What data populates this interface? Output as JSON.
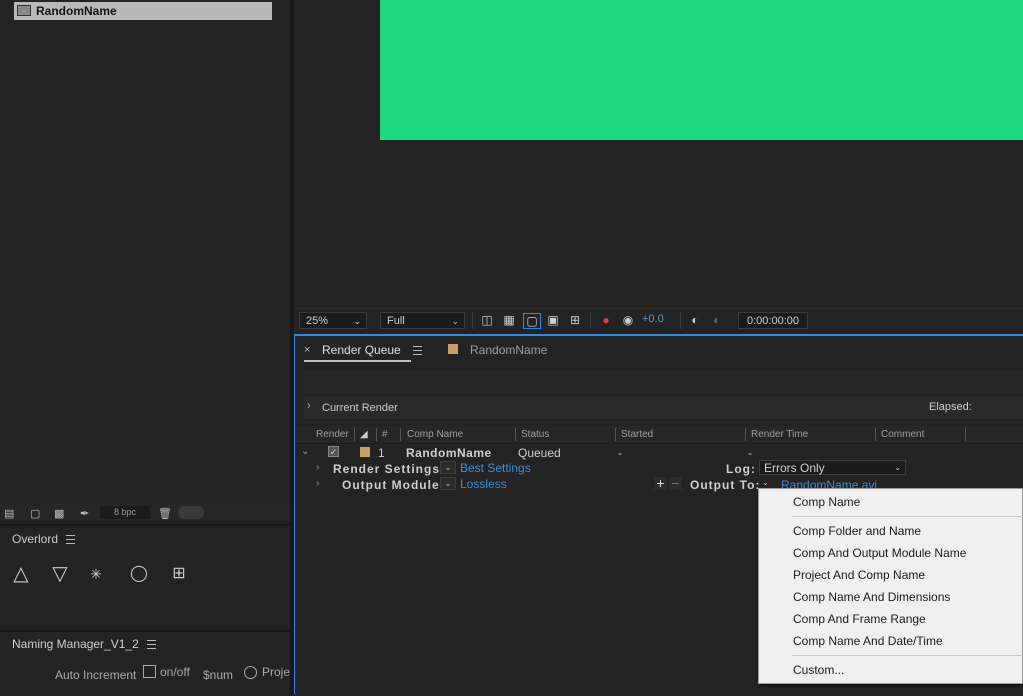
{
  "project": {
    "item_name": "RandomName",
    "footer": {
      "bpc": "8 bpc"
    }
  },
  "overlord": {
    "title": "Overlord"
  },
  "naming_manager": {
    "title": "Naming Manager_V1_2",
    "auto_increment_label": "Auto Increment",
    "onoff_label": "on/off",
    "snum_label": "$num",
    "proj_label": "Proje"
  },
  "viewer": {
    "zoom": "25%",
    "resolution": "Full",
    "exposure": "+0.0",
    "timecode": "0:00:00:00",
    "comp_color": "#1ed97e"
  },
  "render_queue": {
    "tab_label": "Render Queue",
    "comp_tab_label": "RandomName",
    "current_render_label": "Current Render",
    "elapsed_label": "Elapsed:",
    "columns": {
      "render": "Render",
      "num": "#",
      "comp_name": "Comp Name",
      "status": "Status",
      "started": "Started",
      "render_time": "Render Time",
      "comment": "Comment"
    },
    "item": {
      "num": "1",
      "comp_name": "RandomName",
      "status": "Queued",
      "started": "-",
      "render_time": "-"
    },
    "render_settings": {
      "label": "Render Settings",
      "value": "Best Settings"
    },
    "log": {
      "label": "Log:",
      "value": "Errors Only"
    },
    "output_module": {
      "label": "Output Module",
      "value": "Lossless"
    },
    "output_to": {
      "label": "Output To:",
      "file": "RandomName.avi"
    }
  },
  "popup_menu": {
    "items": [
      "Comp Name",
      "Comp Folder and Name",
      "Comp And Output Module Name",
      "Project And Comp Name",
      "Comp Name And Dimensions",
      "Comp And Frame Range",
      "Comp Name And Date/Time",
      "Custom..."
    ]
  }
}
